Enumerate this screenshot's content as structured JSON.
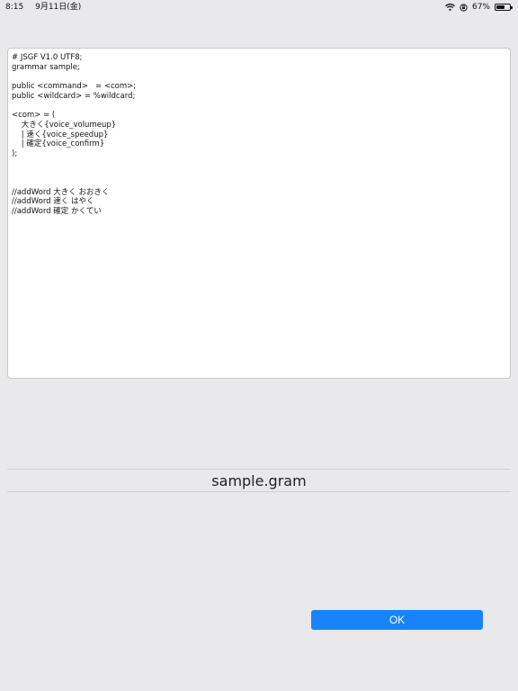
{
  "status_bar": {
    "time": "8:15",
    "date": "9月11日(金)",
    "battery_text": "67%",
    "battery_level": 0.67,
    "icons": [
      "wifi-icon",
      "lock-rotation-icon",
      "battery-icon"
    ]
  },
  "editor": {
    "lines": [
      "# JSGF V1.0 UTF8;",
      "grammar sample;",
      "",
      "public <command>   = <com>;",
      "public <wildcard> = %wildcard;",
      "",
      "<com> = (",
      "    大きく{voice_volumeup}",
      "    | 速く{voice_speedup}",
      "    | 確定{voice_confirm}",
      ");",
      "",
      "",
      "",
      "//addWord 大きく おおきく",
      "//addWord 速く はやく",
      "//addWord 確定 かくてい"
    ]
  },
  "filename": "sample.gram",
  "ok_button_label": "OK",
  "colors": {
    "background": "#e9e8ea",
    "accent": "#1a82fb"
  }
}
